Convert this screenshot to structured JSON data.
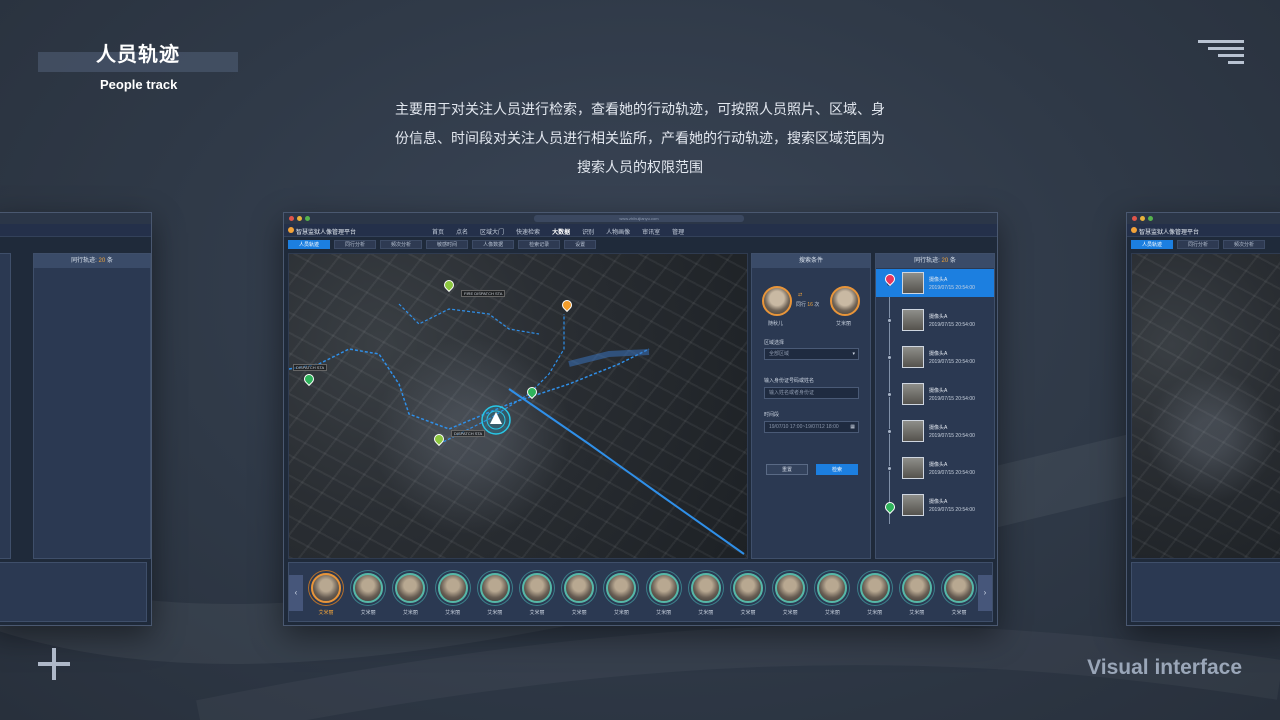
{
  "header": {
    "title_cn": "人员轨迹",
    "title_en": "People track"
  },
  "description": [
    "主要用于对关注人员进行检索，查看她的行动轨迹，可按照人员照片、区域、身",
    "份信息、时间段对关注人员进行相关监所，产看她的行动轨迹，搜索区域范围为",
    "搜索人员的权限范围"
  ],
  "footer": {
    "label": "Visual interface"
  },
  "app": {
    "url": "www.zhihuijianyu.com",
    "title": "智慧监狱人像管理平台",
    "nav": [
      "首页",
      "点名",
      "区域大门",
      "快速检索",
      "大数据",
      "识别",
      "人物画像",
      "审讯室",
      "管理"
    ],
    "nav_active": "大数据",
    "tabs": [
      "人员轨迹",
      "同行分析",
      "频次分析",
      "敏感时间",
      "人像数据",
      "检索记录",
      "设置"
    ],
    "tab_active": "人员轨迹"
  },
  "search_panel": {
    "header": "搜索条件",
    "person_a": "随秋儿",
    "person_b": "艾米丽",
    "together_label": "同行",
    "together_count": "16",
    "together_unit": "次",
    "area_label": "区域选择",
    "area_value": "全部区域",
    "id_label": "输入身份证号码或姓名",
    "id_placeholder": "输入姓名或者身份证",
    "time_label": "时间段",
    "time_value": "19/07/10 17:00~19/07/12 18:00",
    "reset_label": "重置",
    "search_label": "检索"
  },
  "track_panel": {
    "header_prefix": "同行轨迹:",
    "header_count": "20",
    "header_unit": "条",
    "rows": [
      {
        "name": "摄像头A",
        "time": "2019/07/15   20:54:00"
      },
      {
        "name": "摄像头A",
        "time": "2019/07/15   20:54:00"
      },
      {
        "name": "摄像头A",
        "time": "2019/07/15   20:54:00"
      },
      {
        "name": "摄像头A",
        "time": "2019/07/15   20:54:00"
      },
      {
        "name": "摄像头A",
        "time": "2019/07/15   20:54:00"
      },
      {
        "name": "摄像头A",
        "time": "2019/07/15   20:54:00"
      },
      {
        "name": "摄像头A",
        "time": "2019/07/15   20:54:00"
      }
    ]
  },
  "face_strip": {
    "names": [
      "艾米丽",
      "艾米丽",
      "艾米丽",
      "艾米丽",
      "艾米丽",
      "艾米丽",
      "艾米丽",
      "艾米丽",
      "艾米丽",
      "艾米丽",
      "艾米丽",
      "艾米丽",
      "艾米丽",
      "艾米丽",
      "艾米丽",
      "艾米丽"
    ],
    "selected_index": 0
  },
  "map_labels": [
    "FIRE DISPATCH STA",
    "DISPATCH STA",
    "DISPATCH STA"
  ],
  "colors": {
    "accent": "#1c7fe0",
    "highlight": "#f2a43a",
    "route": "#2f8fe8"
  }
}
